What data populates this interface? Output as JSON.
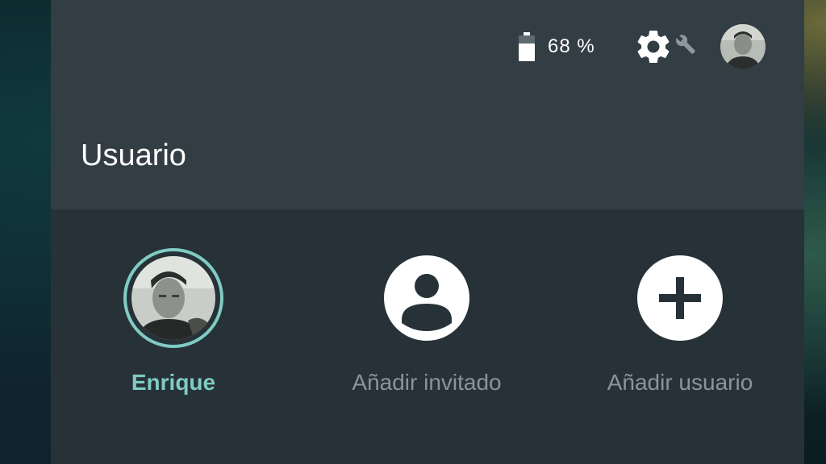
{
  "colors": {
    "panel_bg": "#263238",
    "header_bg": "#333d44",
    "accent": "#80cbc4",
    "muted_text": "#8a9599",
    "white": "#ffffff"
  },
  "status_bar": {
    "battery_icon": "battery-icon",
    "battery_level": 0.68,
    "battery_text": "68 %",
    "settings_icon": "gear-icon",
    "wrench_icon": "wrench-icon",
    "avatar": "user-avatar-photo"
  },
  "header": {
    "title": "Usuario"
  },
  "users": [
    {
      "label": "Enrique",
      "icon": "user-avatar-photo",
      "selected": true
    },
    {
      "label": "Añadir invitado",
      "icon": "person-icon",
      "selected": false
    },
    {
      "label": "Añadir usuario",
      "icon": "plus-icon",
      "selected": false
    }
  ]
}
